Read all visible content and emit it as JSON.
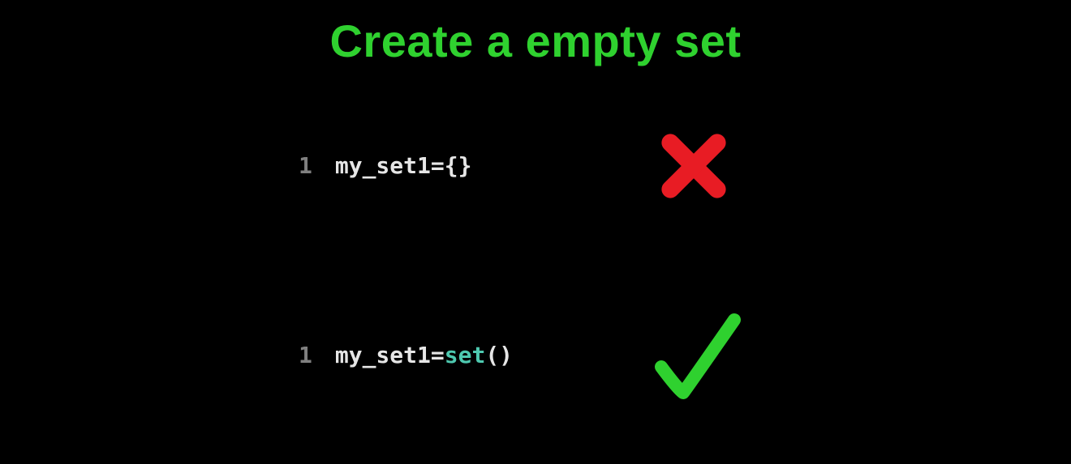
{
  "title": "Create a empty set",
  "code1": {
    "line_num": "1",
    "ident": "my_set1 ",
    "op": "= ",
    "rest": "{}"
  },
  "code2": {
    "line_num": "1",
    "ident": "my_set1 ",
    "op": "= ",
    "func": "set",
    "parens": "()"
  },
  "icons": {
    "cross_color": "#e81c24",
    "check_color": "#2fd12f"
  }
}
